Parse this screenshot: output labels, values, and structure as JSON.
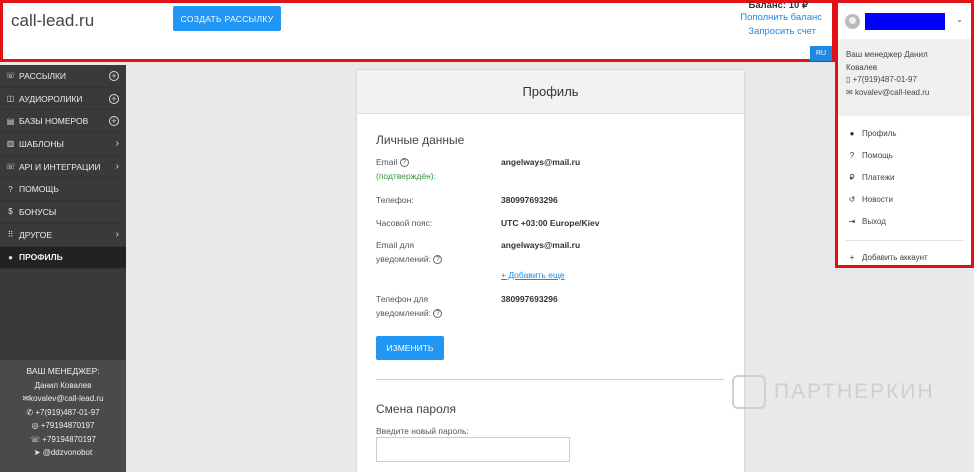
{
  "header": {
    "logo": "call-lead.ru",
    "create_button": "СОЗДАТЬ РАССЫЛКУ",
    "balance": "Баланс: 10 ₽",
    "top_up": "Пополнить баланс",
    "request_invoice": "Запросить счет",
    "language": "RU"
  },
  "sidebar": {
    "items": [
      {
        "label": "РАССЫЛКИ",
        "icon": "phone-icon",
        "right": "plus"
      },
      {
        "label": "АУДИОРОЛИКИ",
        "icon": "audio-icon",
        "right": "plus"
      },
      {
        "label": "БАЗЫ НОМЕРОВ",
        "icon": "list-icon",
        "right": "plus"
      },
      {
        "label": "ШАБЛОНЫ",
        "icon": "template-icon",
        "right": "chevron"
      },
      {
        "label": "API И ИНТЕГРАЦИИ",
        "icon": "api-icon",
        "right": "chevron"
      },
      {
        "label": "ПОМОЩЬ",
        "icon": "help-icon",
        "right": ""
      },
      {
        "label": "БОНУСЫ",
        "icon": "dollar-icon",
        "right": ""
      },
      {
        "label": "ДРУГОЕ",
        "icon": "grid-icon",
        "right": "chevron"
      },
      {
        "label": "ПРОФИЛЬ",
        "icon": "user-icon",
        "right": ""
      }
    ],
    "manager": {
      "heading": "ВАШ МЕНЕДЖЕР:",
      "name": "Данил Ковалев",
      "email": "kovalev@call-lead.ru",
      "phone": "+7(919)487-01-97",
      "whatsapp": "+79194870197",
      "viber": "+79194870197",
      "telegram": "@ddzvonobot"
    }
  },
  "profile": {
    "title": "Профиль",
    "personal_title": "Личные данные",
    "email_label": "Email",
    "confirmed": "(подтверждён):",
    "email_value": "angelways@mail.ru",
    "phone_label": "Телефон:",
    "phone_value": "380997693296",
    "tz_label": "Часовой пояс:",
    "tz_value": "UTC +03:00 Europe/Kiev",
    "notify_email_label_1": "Email для",
    "notify_email_label_2": "уведомлений:",
    "notify_email_value": "angelways@mail.ru",
    "add_more": "+ Добавить еще",
    "notify_phone_label_1": "Телефон для",
    "notify_phone_label_2": "уведомлений:",
    "notify_phone_value": "380997693296",
    "edit_button": "ИЗМЕНИТЬ",
    "password_title": "Смена пароля",
    "new_password_label": "Введите новый пароль:"
  },
  "account_menu": {
    "manager_line1": "Ваш менеджер Данил",
    "manager_line2": "Ковалев",
    "manager_phone": "+7(919)487-01-97",
    "manager_email": "kovalev@call-lead.ru",
    "items": [
      {
        "label": "Профиль",
        "icon": "user-icon"
      },
      {
        "label": "Помощь",
        "icon": "help-icon"
      },
      {
        "label": "Платежи",
        "icon": "ruble-icon"
      },
      {
        "label": "Новости",
        "icon": "history-icon"
      },
      {
        "label": "Выход",
        "icon": "logout-icon"
      }
    ],
    "add_account": "Добавить аккаунт"
  },
  "watermark": "ПАРТНЕРКИН",
  "colors": {
    "accent": "#2196f3",
    "highlight": "#e01218",
    "sidebar": "#3a3a3a",
    "redaction": "#0000ff"
  }
}
